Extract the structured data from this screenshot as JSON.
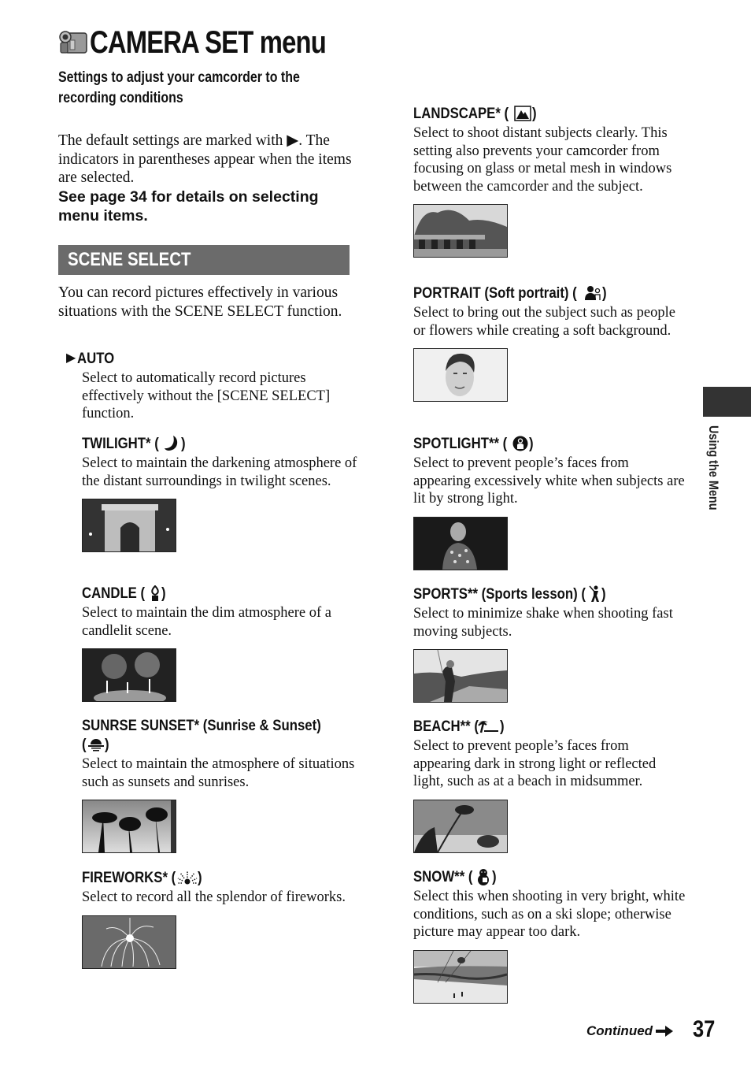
{
  "header": {
    "icon": "camcorder-icon",
    "title": "CAMERA SET menu",
    "subtitle_line1": "Settings to adjust your camcorder to the",
    "subtitle_line2": "recording conditions"
  },
  "intro": {
    "text": "The default settings are marked with ▶. The indicators in parentheses appear when the items are selected.",
    "see_page": "See page 34 for details on selecting menu items."
  },
  "section": {
    "title": "SCENE SELECT",
    "intro": "You can record pictures effectively in various situations with the SCENE SELECT function."
  },
  "default_marker": "▶",
  "items": [
    {
      "label": "AUTO",
      "icon": "",
      "default": true,
      "description": "Select to automatically record pictures effectively without the [SCENE SELECT] function.",
      "image": ""
    },
    {
      "label": "TWILIGHT* (",
      "icon": "moon-icon",
      "label_end": ")",
      "description": "Select to maintain the darkening atmosphere of the distant surroundings in twilight scenes.",
      "image": "arc-de-triomphe-night"
    },
    {
      "label": "CANDLE (",
      "icon": "candle-icon",
      "label_end": ")",
      "description": "Select to maintain the dim atmosphere of a candlelit scene.",
      "image": "birthday-candles"
    },
    {
      "label": "SUNRSE SUNSET* (Sunrise & Sunset)",
      "label_line2": "(",
      "icon": "sunset-icon",
      "label_end": ")",
      "description": "Select to maintain the atmosphere of situations such as sunsets and sunrises.",
      "image": "palm-silhouettes"
    },
    {
      "label": "FIREWORKS* (",
      "icon": "fireworks-icon",
      "label_end": ")",
      "description": "Select to record all the splendor of fireworks.",
      "image": "firework-burst"
    },
    {
      "label": "LANDSCAPE* (",
      "icon": "landscape-icon",
      "label_end": ")",
      "description": "Select to shoot distant subjects clearly. This setting also prevents your camcorder from focusing on glass or metal mesh in windows between the camcorder and the subject.",
      "image": "park-landscape"
    },
    {
      "label": "PORTRAIT (Soft portrait) (",
      "icon": "portrait-icon",
      "label_end": ")",
      "description": "Select to bring out the subject such as people or flowers while creating a soft background.",
      "image": "woman-portrait"
    },
    {
      "label": "SPOTLIGHT** (",
      "icon": "spotlight-icon",
      "label_end": ")",
      "description": "Select to prevent people’s faces from appearing excessively white when subjects are lit by strong light.",
      "image": "woman-spotlight"
    },
    {
      "label": "SPORTS** (Sports lesson) (",
      "icon": "golfer-icon",
      "label_end": ")",
      "description": "Select to minimize shake when shooting fast moving subjects.",
      "image": "golfer-swing"
    },
    {
      "label": "BEACH** (",
      "icon": "beach-icon",
      "label_end": ")",
      "description": "Select to prevent people’s faces from appearing dark in strong light or reflected light, such as at a beach in midsummer.",
      "image": "tropical-beach"
    },
    {
      "label": "SNOW** (",
      "icon": "snowman-icon",
      "label_end": ")",
      "description": "Select this when shooting in very bright, white conditions, such as on a ski slope; otherwise picture may appear too dark.",
      "image": "ski-slope"
    }
  ],
  "side_tab": {
    "label": "Using the Menu"
  },
  "footer": {
    "continued": "Continued",
    "page_number": "37"
  },
  "colors": {
    "section_bar": "#6b6b6b",
    "side_tab": "#333333",
    "text": "#111111"
  }
}
